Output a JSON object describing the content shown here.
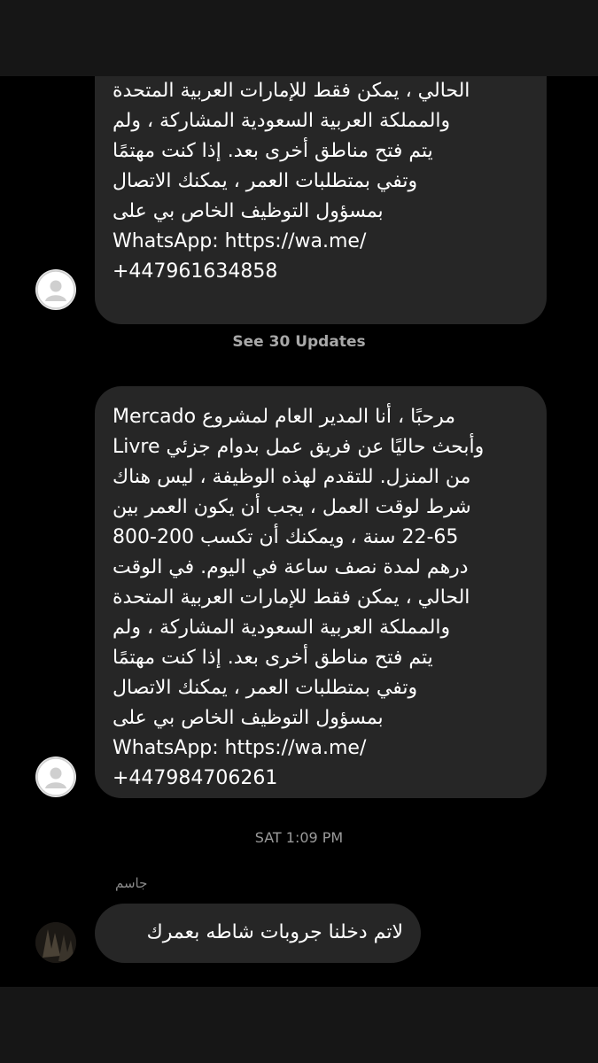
{
  "thread": {
    "messages": [
      {
        "text": "الحالي ، يمكن فقط للإمارات العربية المتحدة\nوالمملكة العربية السعودية المشاركة ، ولم\nيتم فتح مناطق أخرى بعد. إذا كنت مهتمًا\nوتفي بمتطلبات العمر ، يمكنك الاتصال\nبمسؤول التوظيف الخاص بي على\nWhatsApp: https://wa.me/\n+447961634858"
      },
      {
        "text": "مرحبًا ، أنا المدير العام لمشروع Mercado\nLivre وأبحث حاليًا عن فريق عمل بدوام جزئي\nمن المنزل. للتقدم لهذه الوظيفة ، ليس هناك\nشرط لوقت العمل ، يجب أن يكون العمر بين\n22-65 سنة ، ويمكنك أن تكسب 200-800\nدرهم لمدة نصف ساعة في اليوم. في الوقت\nالحالي ، يمكن فقط للإمارات العربية المتحدة\nوالمملكة العربية السعودية المشاركة ، ولم\nيتم فتح مناطق أخرى بعد. إذا كنت مهتمًا\nوتفي بمتطلبات العمر ، يمكنك الاتصال\nبمسؤول التوظيف الخاص بي على\nWhatsApp: https://wa.me/\n+447984706261"
      },
      {
        "sender": "جاسم",
        "text": "لاتم دخلنا جروبات شاطه بعمرك"
      }
    ],
    "see_updates": "See 30 Updates",
    "timestamp": "SAT 1:09 PM"
  },
  "icons": {
    "default_avatar": "default-avatar-icon",
    "user_avatar": "user-avatar-icon"
  },
  "colors": {
    "background": "#000000",
    "bubble": "#262626",
    "meta_text": "#9a9a9a"
  }
}
